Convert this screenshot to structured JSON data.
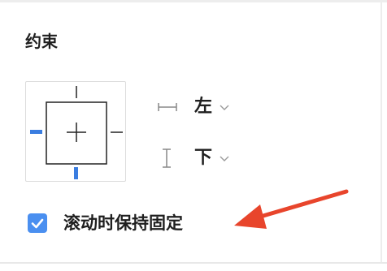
{
  "section": {
    "title": "约束"
  },
  "horizontal": {
    "value": "左",
    "icon": "horizontal-constraint-icon"
  },
  "vertical": {
    "value": "下",
    "icon": "vertical-constraint-icon"
  },
  "fix_on_scroll": {
    "label": "滚动时保持固定",
    "checked": true
  },
  "colors": {
    "accent": "#4a8ff0",
    "constraint_active": "#3a7de0",
    "arrow": "#e8452c"
  }
}
